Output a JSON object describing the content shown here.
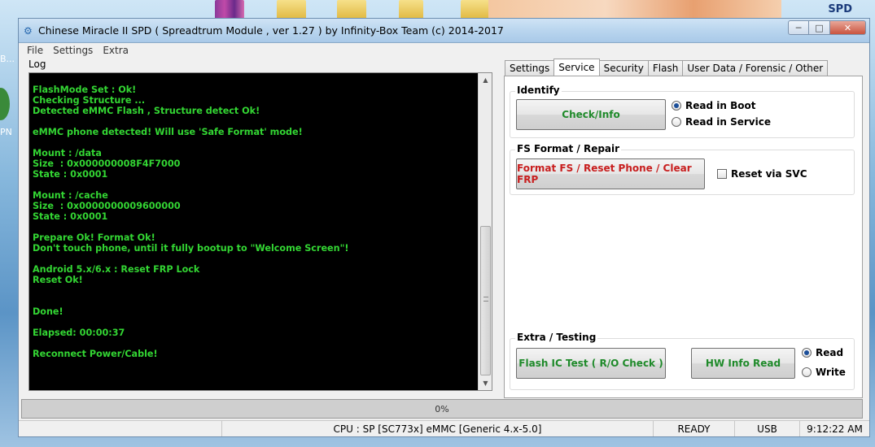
{
  "window": {
    "title": "Chinese Miracle II SPD ( Spreadtrum Module , ver 1.27 ) by Infinity-Box Team (c) 2014-2017",
    "controls": {
      "minimize": "─",
      "maximize": "□",
      "close": "✕"
    }
  },
  "desktop": {
    "spd_label": "SPD",
    "left_label_1": "B...",
    "left_label_2": "PN"
  },
  "menu": {
    "items": [
      "File",
      "Settings",
      "Extra"
    ]
  },
  "log": {
    "label": "Log",
    "lines": [
      "FlashMode Set : Ok!",
      "Checking Structure ...",
      "Detected eMMC Flash , Structure detect Ok!",
      "",
      "eMMC phone detected! Will use 'Safe Format' mode!",
      "",
      "Mount : /data",
      "Size  : 0x000000008F4F7000",
      "State : 0x0001",
      "",
      "Mount : /cache",
      "Size  : 0x0000000009600000",
      "State : 0x0001",
      "",
      "Prepare Ok! Format Ok!",
      "Don't touch phone, until it fully bootup to \"Welcome Screen\"!",
      "",
      "Android 5.x/6.x : Reset FRP Lock",
      "Reset Ok!",
      "",
      "",
      "Done!",
      "",
      "Elapsed: 00:00:37",
      "",
      "Reconnect Power/Cable!"
    ]
  },
  "tabs": [
    {
      "label": "Settings",
      "active": false
    },
    {
      "label": "Service",
      "active": true
    },
    {
      "label": "Security",
      "active": false
    },
    {
      "label": "Flash",
      "active": false
    },
    {
      "label": "User Data / Forensic / Other",
      "active": false
    }
  ],
  "identify": {
    "title": "Identify",
    "check_button": "Check/Info",
    "read_in_boot": "Read in Boot",
    "read_in_service": "Read in Service",
    "selected": "Read in Boot"
  },
  "fs_format": {
    "title": "FS Format / Repair",
    "format_button": "Format FS / Reset Phone / Clear FRP",
    "reset_via_svc": "Reset via SVC",
    "reset_via_svc_checked": false
  },
  "extra_testing": {
    "title": "Extra / Testing",
    "flash_ic_button": "Flash IC Test ( R/O Check )",
    "hw_info_button": "HW Info Read",
    "read": "Read",
    "write": "Write",
    "selected": "Read"
  },
  "progress": {
    "percent": 0,
    "label": "0%"
  },
  "status": {
    "cpu": "CPU : SP [SC773x] eMMC [Generic 4.x-5.0]",
    "state": "READY",
    "port": "USB",
    "time": "9:12:22 AM"
  },
  "colors": {
    "log_text": "#33d633",
    "green_button_text": "#1f8a2a",
    "red_button_text": "#c81e1e"
  }
}
